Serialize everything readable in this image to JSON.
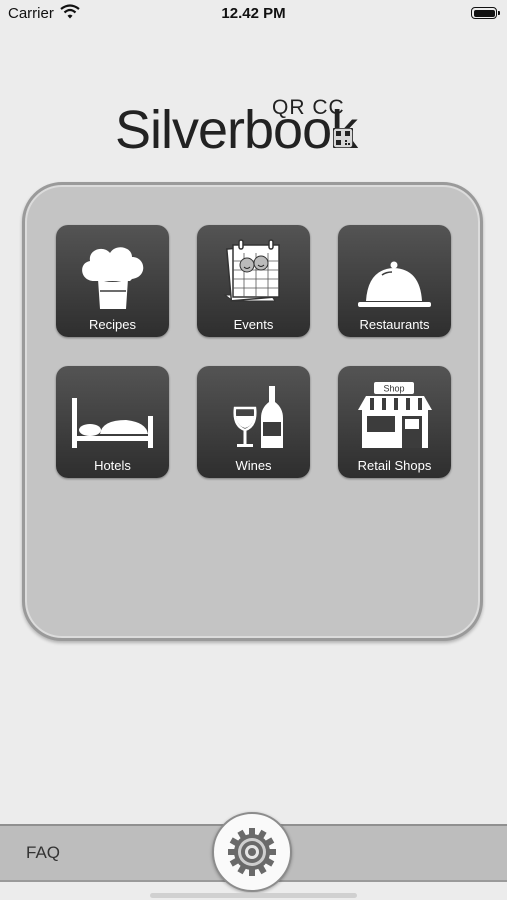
{
  "status_bar": {
    "carrier": "Carrier",
    "time": "12.42 PM"
  },
  "logo": {
    "main": "Silverbook",
    "sub": "QR CC"
  },
  "tiles": [
    {
      "label": "Recipes",
      "icon": "chef-hat-icon"
    },
    {
      "label": "Events",
      "icon": "calendar-icon"
    },
    {
      "label": "Restaurants",
      "icon": "cloche-icon"
    },
    {
      "label": "Hotels",
      "icon": "bed-icon"
    },
    {
      "label": "Wines",
      "icon": "wine-icon"
    },
    {
      "label": "Retail Shops",
      "icon": "shop-icon",
      "sign": "Shop"
    }
  ],
  "bottom_bar": {
    "faq_label": "FAQ",
    "settings_icon": "gear-icon"
  }
}
